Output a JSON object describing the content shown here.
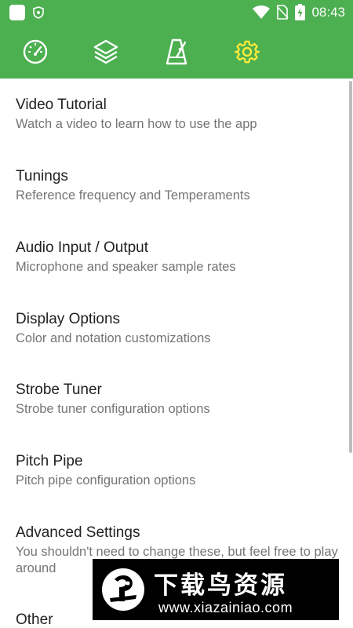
{
  "status_bar": {
    "time": "08:43",
    "icons": [
      "app-square-icon",
      "shield-icon",
      "wifi-icon",
      "no-sim-icon",
      "battery-charging-icon"
    ]
  },
  "app_bar": {
    "tabs": [
      {
        "icon": "tuner-gauge-icon",
        "selected": false
      },
      {
        "icon": "layers-icon",
        "selected": false
      },
      {
        "icon": "metronome-icon",
        "selected": false
      },
      {
        "icon": "gear-icon",
        "selected": true
      }
    ],
    "colors": {
      "bar": "#4caf50",
      "icon": "#ffffff",
      "selected_icon": "#ffeb3b"
    }
  },
  "settings": {
    "items": [
      {
        "title": "Video Tutorial",
        "subtitle": "Watch a video to learn how to use the app"
      },
      {
        "title": "Tunings",
        "subtitle": "Reference frequency and Temperaments"
      },
      {
        "title": "Audio Input / Output",
        "subtitle": "Microphone and speaker sample rates"
      },
      {
        "title": "Display Options",
        "subtitle": "Color and notation customizations"
      },
      {
        "title": "Strobe Tuner",
        "subtitle": "Strobe tuner configuration options"
      },
      {
        "title": "Pitch Pipe",
        "subtitle": "Pitch pipe configuration options"
      },
      {
        "title": "Advanced Settings",
        "subtitle": "You shouldn't need to change these, but feel free to play around"
      },
      {
        "title": "Other",
        "subtitle": ""
      }
    ]
  },
  "watermark": {
    "text": "下载鸟资源",
    "url": "www.xiazainiao.com"
  }
}
